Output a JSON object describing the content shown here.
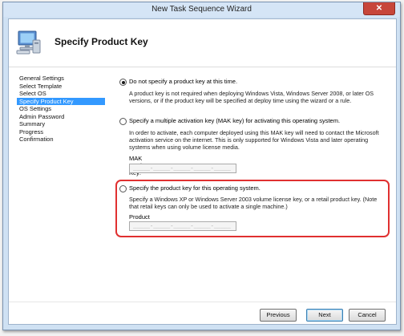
{
  "window": {
    "title": "New Task Sequence Wizard",
    "close_glyph": "✕"
  },
  "header": {
    "title": "Specify Product Key"
  },
  "nav": {
    "items": [
      {
        "label": "General Settings",
        "active": false
      },
      {
        "label": "Select Template",
        "active": false
      },
      {
        "label": "Select OS",
        "active": false
      },
      {
        "label": "Specify Product Key",
        "active": true
      },
      {
        "label": "OS Settings",
        "active": false
      },
      {
        "label": "Admin Password",
        "active": false
      },
      {
        "label": "Summary",
        "active": false
      },
      {
        "label": "Progress",
        "active": false
      },
      {
        "label": "Confirmation",
        "active": false
      }
    ]
  },
  "options": {
    "no_key": {
      "label": "Do not specify a product key at this time.",
      "selected": true,
      "description": "A product key is not required when deploying Windows Vista, Windows Server 2008, or later OS versions, or if the product key will be specified at deploy time using the wizard or a rule."
    },
    "mak": {
      "label": "Specify a multiple activation key (MAK key) for activating this operating system.",
      "selected": false,
      "description": "In order to activate, each computer deployed using this MAK key will need to contact the Microsoft activation service on the internet.  This is only supported for Windows Vista and later operating systems when using volume license media.",
      "key_label": "MAK Product Key:",
      "key_mask": "_____-_____-_____-_____-_____"
    },
    "product_key": {
      "label": "Specify the product key for this operating system.",
      "selected": false,
      "description": "Specify a Windows XP or Windows Server 2003 volume license key, or a retail product key.  (Note that retail keys can only be used to activate a single machine.)",
      "key_label": "Product Key:",
      "key_mask": "_____-_____-_____-_____-_____"
    }
  },
  "buttons": {
    "previous": "Previous",
    "next": "Next",
    "cancel": "Cancel"
  },
  "colors": {
    "selection": "#3399ff",
    "highlight_border": "#e03030"
  }
}
